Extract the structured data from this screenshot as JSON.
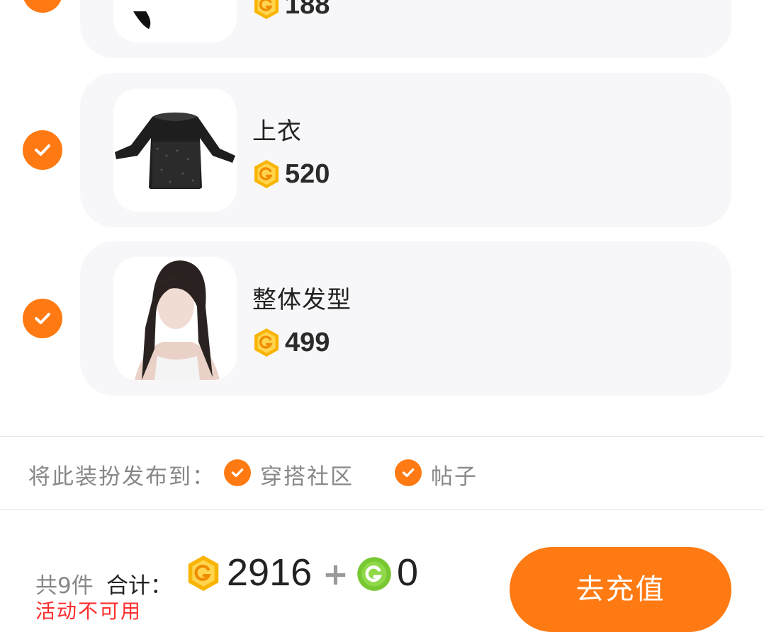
{
  "items": [
    {
      "name": "",
      "price": "188"
    },
    {
      "name": "上衣",
      "price": "520"
    },
    {
      "name": "整体发型",
      "price": "499"
    }
  ],
  "publish": {
    "label": "将此装扮发布到：",
    "options": [
      "穿搭社区",
      "帖子"
    ]
  },
  "footer": {
    "count": "共9件",
    "total_label": "合计：",
    "coin_total": "2916",
    "plus": "+",
    "gem_total": "0",
    "red_note": "活动不可用",
    "recharge_button": "去充值"
  },
  "colors": {
    "accent": "#ff7a12",
    "coin": "#f8b400",
    "gem": "#78c832",
    "card_bg": "#f7f7f9"
  },
  "icons": {
    "check": "check-circle-icon",
    "coin": "gold-coin-icon",
    "gem": "green-coin-icon"
  }
}
